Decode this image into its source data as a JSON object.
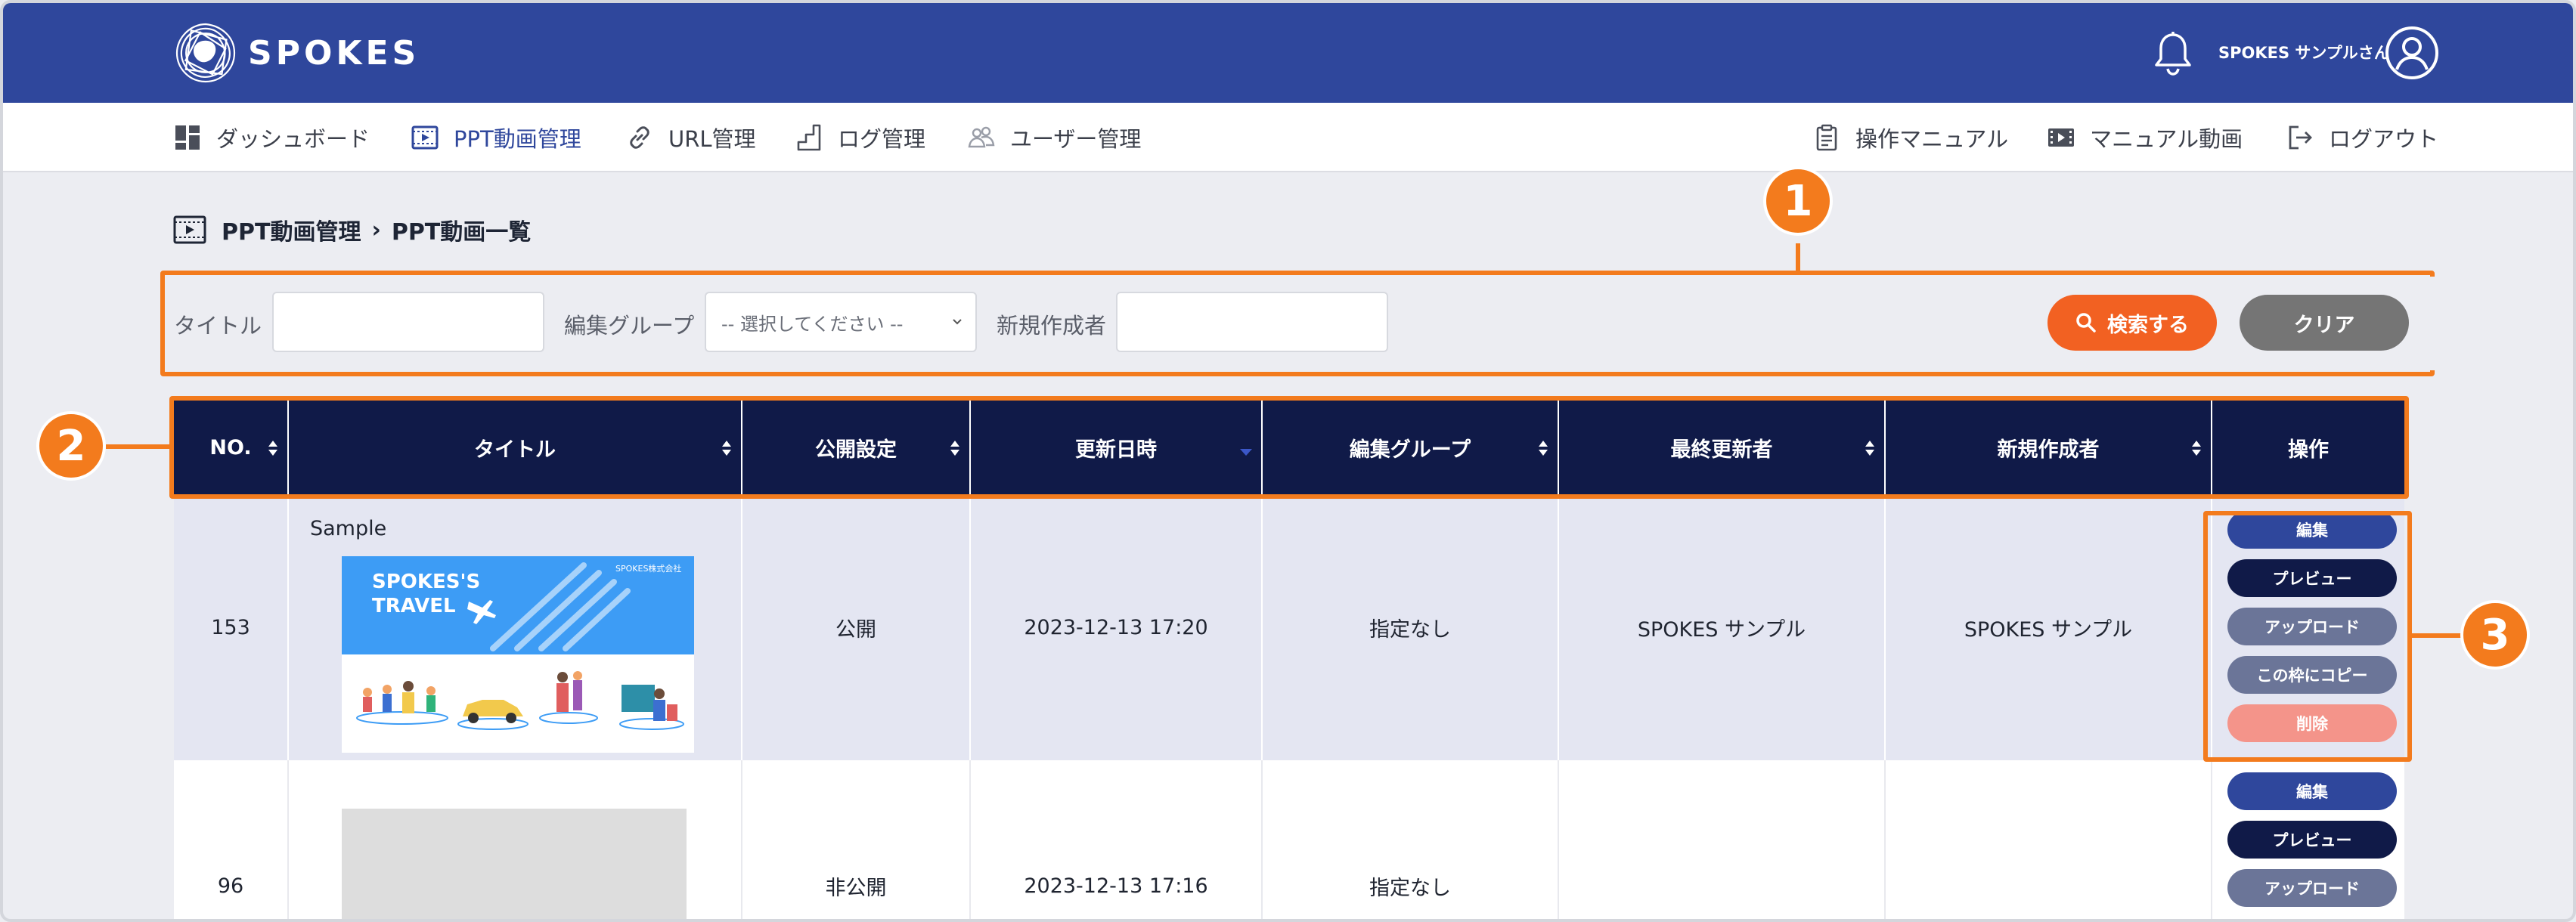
{
  "app": {
    "logo_text": "SPOKES",
    "user_name": "SPOKES サンプルさん"
  },
  "nav": {
    "left": [
      {
        "label": "ダッシュボード",
        "icon": "dashboard-icon"
      },
      {
        "label": "PPT動画管理",
        "icon": "video-icon",
        "active": true
      },
      {
        "label": "URL管理",
        "icon": "link-icon"
      },
      {
        "label": "ログ管理",
        "icon": "log-icon"
      },
      {
        "label": "ユーザー管理",
        "icon": "users-icon"
      }
    ],
    "right": [
      {
        "label": "操作マニュアル",
        "icon": "manual-icon"
      },
      {
        "label": "マニュアル動画",
        "icon": "film-icon"
      },
      {
        "label": "ログアウト",
        "icon": "logout-icon"
      }
    ]
  },
  "breadcrumb": {
    "parent": "PPT動画管理",
    "current": "PPT動画一覧"
  },
  "search": {
    "title_label": "タイトル",
    "title_value": "",
    "group_label": "編集グループ",
    "group_selected": "-- 選択してください --",
    "creator_label": "新規作成者",
    "creator_value": "",
    "search_button": "検索する",
    "clear_button": "クリア"
  },
  "annotations": [
    "1",
    "2",
    "3"
  ],
  "colors": {
    "header_bg": "#2f479c",
    "table_header_bg": "#101a48",
    "annotation_orange": "#f37b1d",
    "search_button": "#f26122",
    "clear_button": "#757575",
    "delete_button": "#f4948a"
  },
  "table": {
    "columns": [
      "NO.",
      "タイトル",
      "公開設定",
      "更新日時",
      "編集グループ",
      "最終更新者",
      "新規作成者",
      "操作"
    ],
    "rows": [
      {
        "no": "153",
        "title": "Sample",
        "thumbnail": {
          "heading_line1": "SPOKES'S",
          "heading_line2": "TRAVEL",
          "company": "SPOKES株式会社"
        },
        "visibility": "公開",
        "updated_at": "2023-12-13 17:20",
        "group": "指定なし",
        "last_editor": "SPOKES サンプル",
        "creator": "SPOKES サンプル",
        "actions": [
          "編集",
          "プレビュー",
          "アップロード",
          "この枠にコピー",
          "削除"
        ]
      },
      {
        "no": "96",
        "title": "",
        "visibility": "非公開",
        "updated_at": "2023-12-13 17:16",
        "group": "指定なし",
        "last_editor": "",
        "creator": "",
        "actions": [
          "編集",
          "プレビュー",
          "アップロード"
        ]
      }
    ]
  }
}
